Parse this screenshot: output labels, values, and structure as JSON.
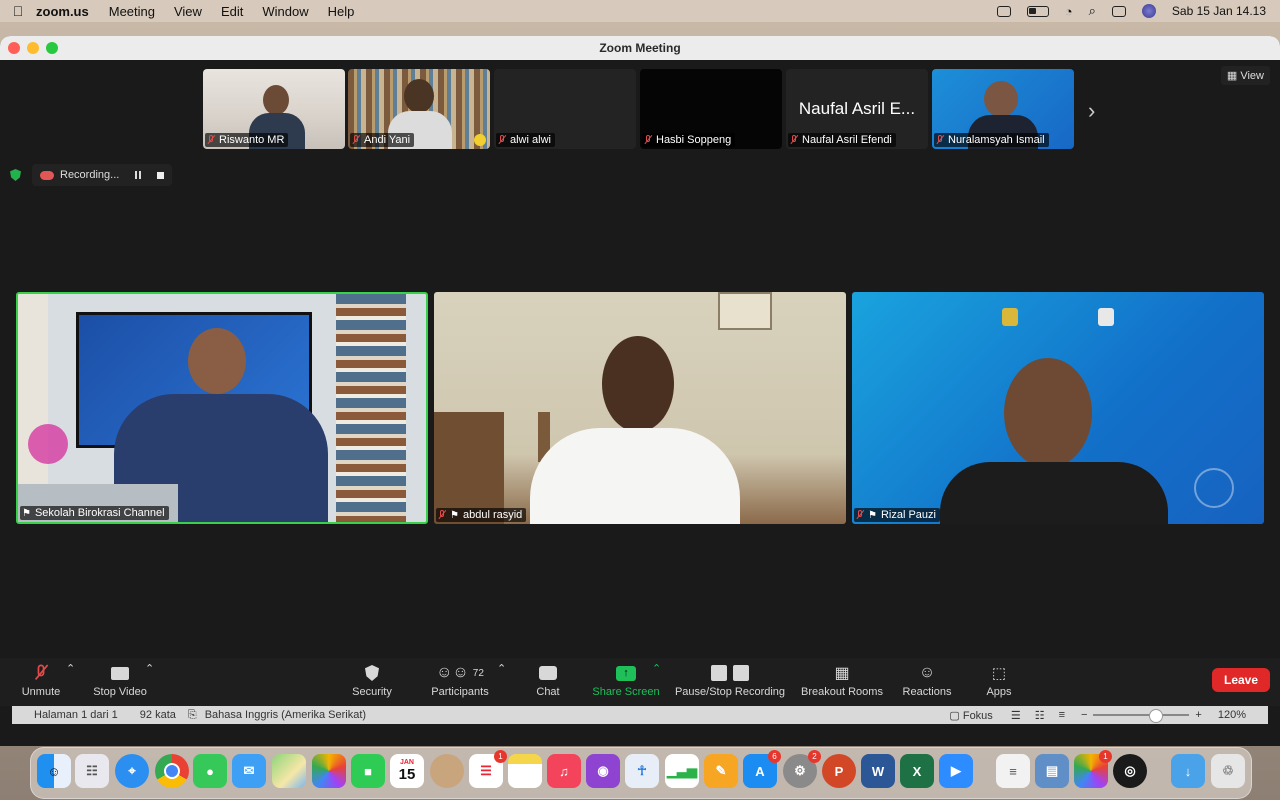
{
  "menubar": {
    "app": "zoom.us",
    "menus": [
      "Meeting",
      "View",
      "Edit",
      "Window",
      "Help"
    ],
    "clock": "Sab 15 Jan  14.13"
  },
  "window": {
    "title": "Zoom Meeting"
  },
  "strip": {
    "participants": [
      {
        "name": "Riswanto MR",
        "muted": true
      },
      {
        "name": "Andi Yani",
        "muted": true
      },
      {
        "name": "alwi alwi",
        "muted": true
      },
      {
        "name": "Hasbi Soppeng",
        "muted": true
      },
      {
        "name": "Naufal Asril Efendi",
        "muted": true,
        "big_label": "Naufal Asril E..."
      },
      {
        "name": "Nuralamsyah Ismail",
        "muted": true
      }
    ],
    "view_label": "View"
  },
  "recording": {
    "label": "Recording..."
  },
  "main": {
    "tiles": [
      {
        "name": "Sekolah Birokrasi Channel",
        "active_speaker": true
      },
      {
        "name": "abdul rasyid",
        "muted": true
      },
      {
        "name": "Rizal Pauzi",
        "muted": true
      }
    ]
  },
  "toolbar": {
    "unmute": "Unmute",
    "stop_video": "Stop Video",
    "security": "Security",
    "participants": "Participants",
    "participants_count": "72",
    "chat": "Chat",
    "share_screen": "Share Screen",
    "recording": "Pause/Stop Recording",
    "breakout": "Breakout Rooms",
    "reactions": "Reactions",
    "apps": "Apps",
    "leave": "Leave"
  },
  "wordbar": {
    "page": "Halaman 1 dari 1",
    "words": "92 kata",
    "language": "Bahasa Inggris (Amerika Serikat)",
    "focus": "Fokus",
    "zoom": "120%"
  },
  "dock": {
    "calendar_month": "JAN",
    "calendar_day": "15",
    "badges": {
      "reminders": "1",
      "appstore": "6",
      "settings": "2",
      "photos": "1"
    }
  },
  "colors": {
    "share_green": "#1fbf5a",
    "leave_red": "#e02828",
    "speaker_border": "#3ad14a"
  }
}
